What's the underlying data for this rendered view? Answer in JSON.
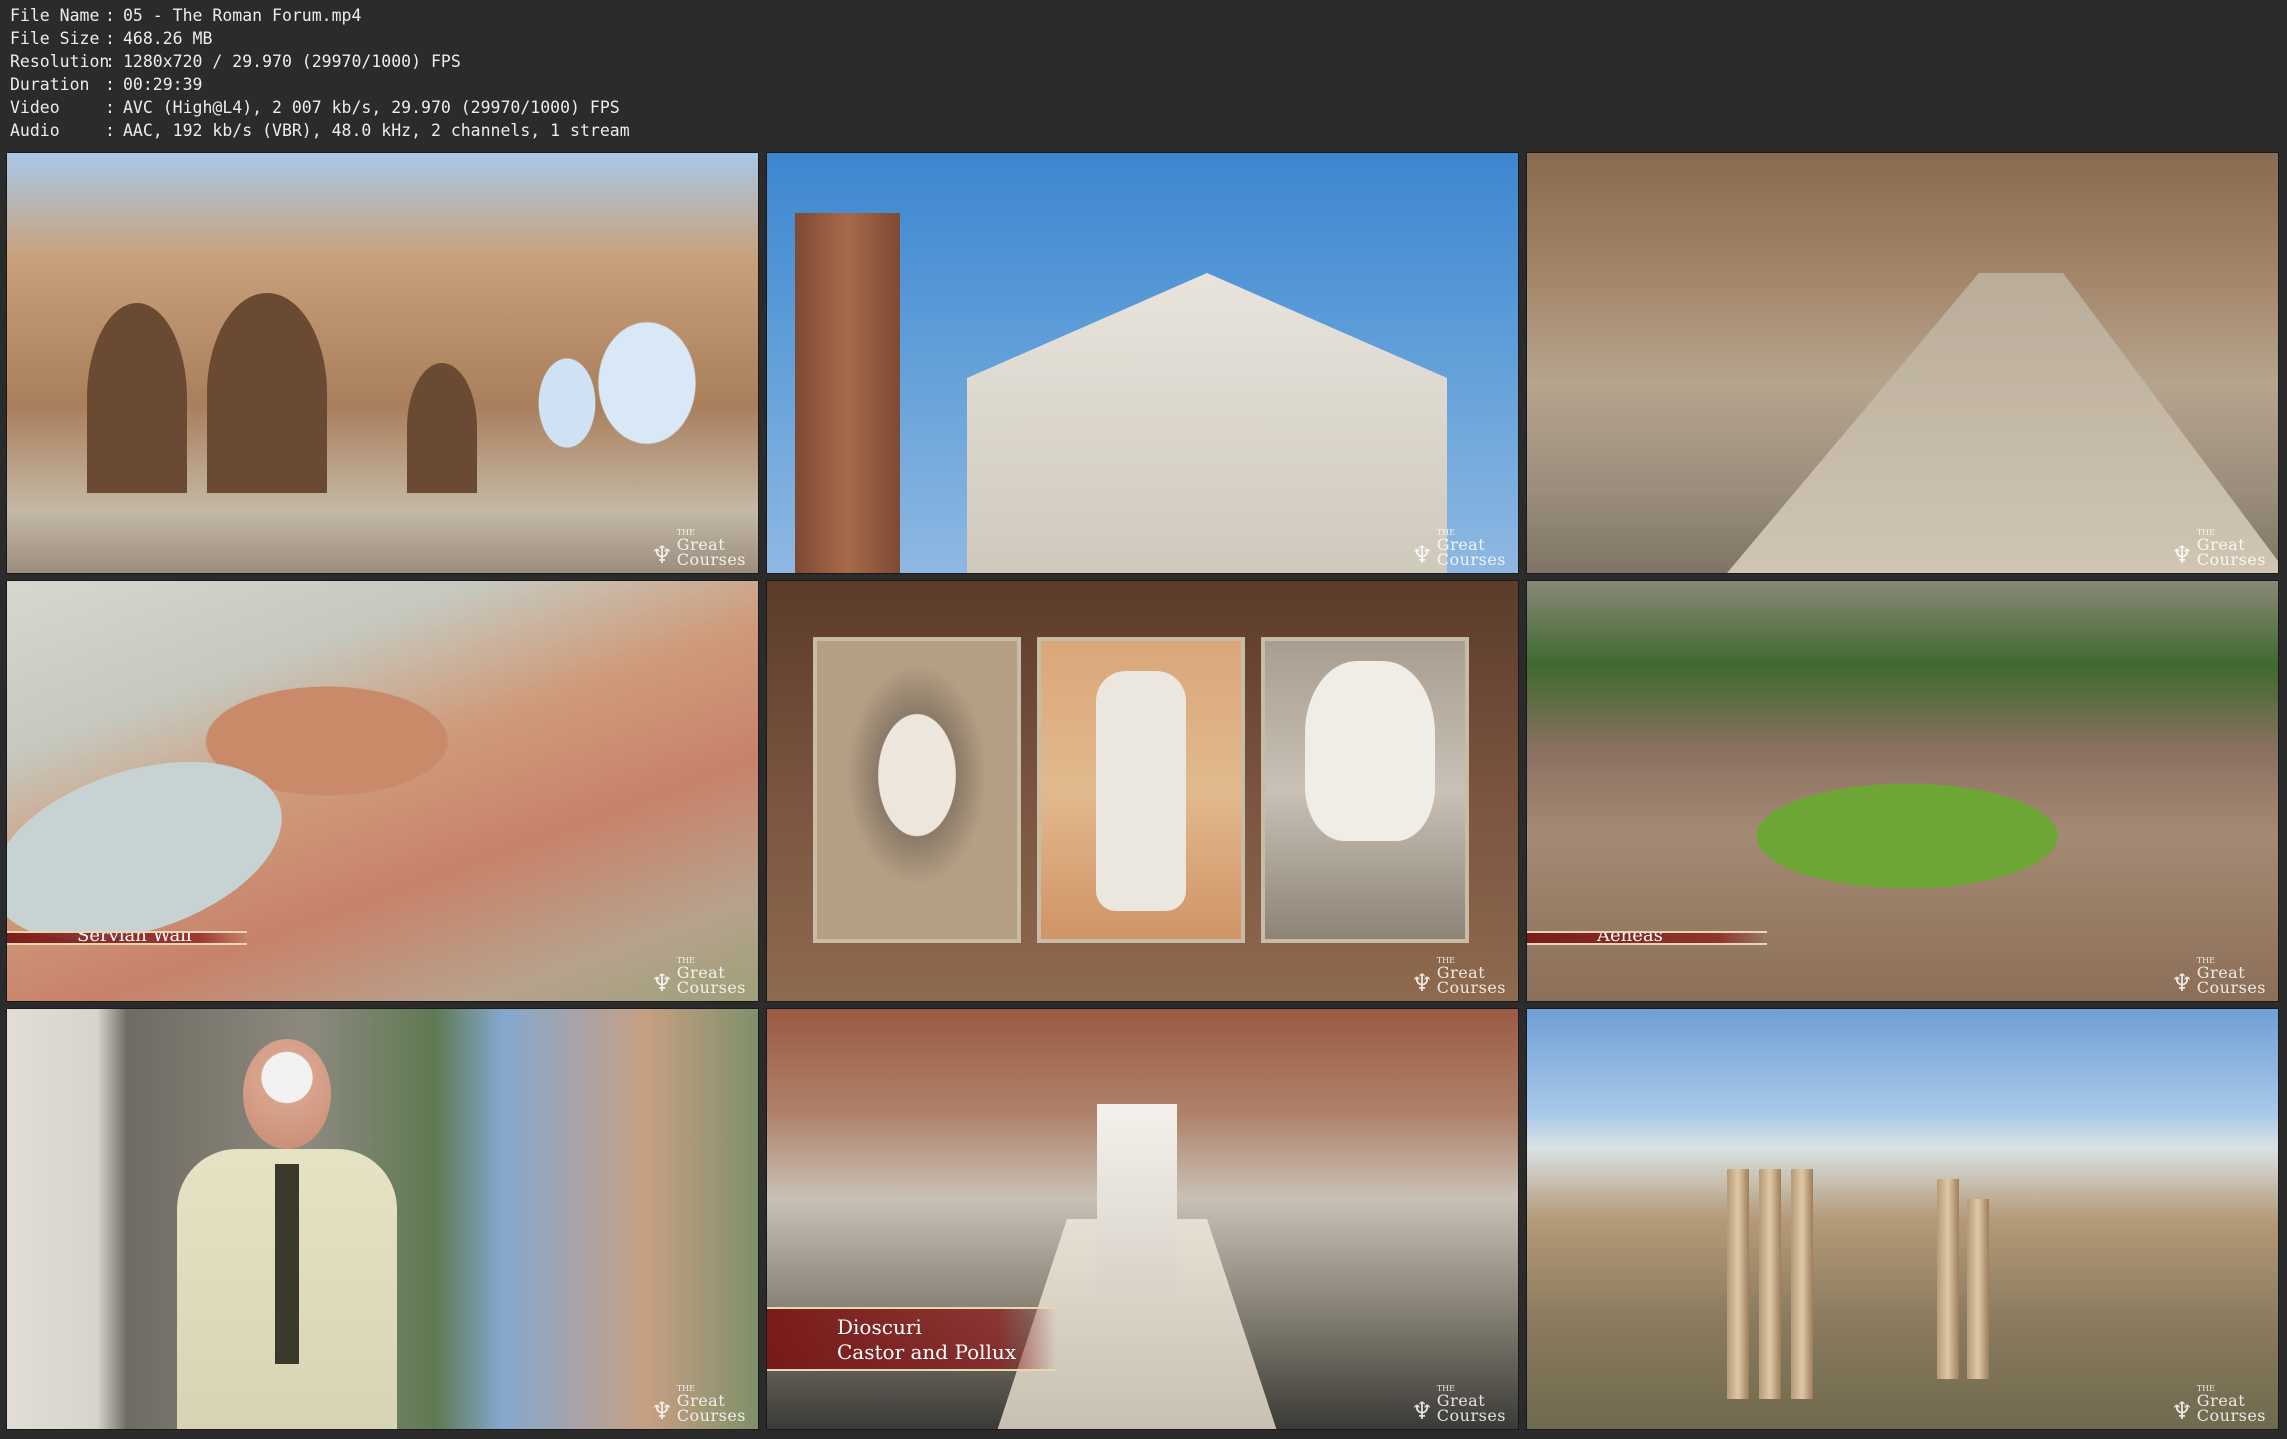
{
  "info": [
    {
      "label": "File Name",
      "value": "05 - The Roman Forum.mp4"
    },
    {
      "label": "File Size",
      "value": "468.26 MB"
    },
    {
      "label": "Resolution",
      "value": "1280x720 / 29.970 (29970/1000) FPS"
    },
    {
      "label": "Duration",
      "value": "00:29:39"
    },
    {
      "label": "Video",
      "value": "AVC (High@L4), 2 007 kb/s, 29.970 (29970/1000) FPS"
    },
    {
      "label": "Audio",
      "value": "AAC, 192 kb/s (VBR), 48.0 kHz, 2 channels, 1 stream"
    }
  ],
  "separator": ":",
  "logo": {
    "the": "THE",
    "great": "Great",
    "courses": "Courses",
    "icon": "torch-icon"
  },
  "captions": {
    "servian_wall": "Servian Wall",
    "aeneas": "Aeneas",
    "dioscuri_line1": "Dioscuri",
    "dioscuri_line2": "Castor and Pollux"
  },
  "colors": {
    "background": "#2b2b2b",
    "text": "#ececec",
    "caption_bg": "#7a1414",
    "caption_border": "#e7d7b0"
  }
}
